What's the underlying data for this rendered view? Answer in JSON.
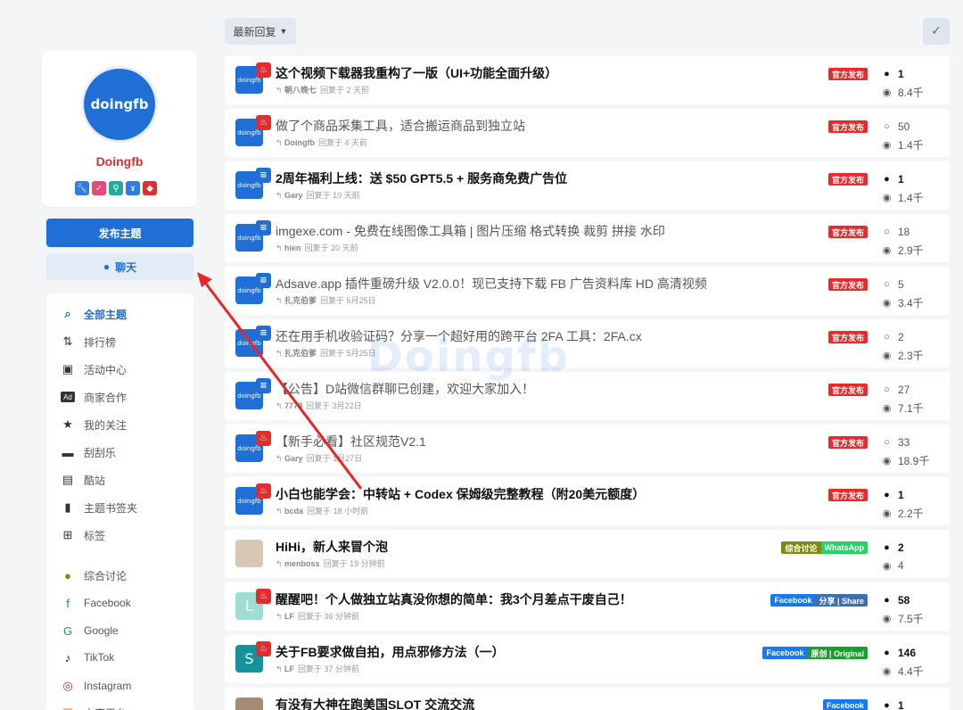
{
  "profile": {
    "avatar_text": "doingfb",
    "name": "Doingfb",
    "badges": [
      {
        "icon": "wrench-icon",
        "glyph": "🔧",
        "color": "#2f7ae5"
      },
      {
        "icon": "check-icon",
        "glyph": "✓",
        "color": "#e64a78"
      },
      {
        "icon": "user-icon",
        "glyph": "⚲",
        "color": "#26a99a"
      },
      {
        "icon": "trophy-icon",
        "glyph": "ɤ",
        "color": "#2f7ae5"
      },
      {
        "icon": "gem-icon",
        "glyph": "◆",
        "color": "#e02d2d"
      }
    ]
  },
  "actions": {
    "post_label": "发布主题",
    "chat_label": "聊天"
  },
  "nav": [
    {
      "label": "全部主题",
      "icon": "discussions-icon",
      "glyph": "⌕",
      "active": true
    },
    {
      "label": "排行榜",
      "icon": "ranking-icon",
      "glyph": "⇅",
      "active": false
    },
    {
      "label": "活动中心",
      "icon": "gift-icon",
      "glyph": "▣",
      "active": false
    },
    {
      "label": "商家合作",
      "icon": "ad-icon",
      "glyph": "Ad",
      "active": false
    },
    {
      "label": "我的关注",
      "icon": "star-icon",
      "glyph": "★",
      "active": false
    },
    {
      "label": "刮刮乐",
      "icon": "ticket-icon",
      "glyph": "▬",
      "active": false
    },
    {
      "label": "酷站",
      "icon": "window-icon",
      "glyph": "▤",
      "active": false
    },
    {
      "label": "主题书签夹",
      "icon": "bookmark-icon",
      "glyph": "▮",
      "active": false
    },
    {
      "label": "标签",
      "icon": "tags-icon",
      "glyph": "⊞",
      "active": false
    },
    {
      "label": "综合讨论",
      "icon": "comments-icon",
      "glyph": "●",
      "active": false,
      "color": "#7a8c12"
    },
    {
      "label": "Facebook",
      "icon": "facebook-icon",
      "glyph": "f",
      "active": false,
      "color": "#1877f2"
    },
    {
      "label": "Google",
      "icon": "google-icon",
      "glyph": "G",
      "active": false,
      "color": "#1a9b4b"
    },
    {
      "label": "TikTok",
      "icon": "tiktok-icon",
      "glyph": "♪",
      "active": false,
      "color": "#111111"
    },
    {
      "label": "Instagram",
      "icon": "instagram-icon",
      "glyph": "◎",
      "active": false,
      "color": "#c2185b"
    },
    {
      "label": "内容平台",
      "icon": "platform-icon",
      "glyph": "▦",
      "active": false,
      "color": "#e67e22"
    }
  ],
  "toolbar": {
    "sort_label": "最新回复"
  },
  "watermark": "Doingfb",
  "topics": [
    {
      "title": "这个视频下载器我重构了一版（UI+功能全面升级）",
      "bold": true,
      "user": "朝八晚七",
      "time": "回复于 2 天前",
      "avatar": "doingfb",
      "flag_color": "#e02d2d",
      "flag_glyph": "♨",
      "tags": [
        {
          "text": "官方发布",
          "color": "#e52b2b"
        }
      ],
      "replies": "1",
      "replies_bold": true,
      "views": "8.4千"
    },
    {
      "title": "做了个商品采集工具，适合搬运商品到独立站",
      "bold": false,
      "user": "Doingfb",
      "time": "回复于 4 天前",
      "avatar": "doingfb",
      "flag_color": "#e02d2d",
      "flag_glyph": "♨",
      "tags": [
        {
          "text": "官方发布",
          "color": "#e52b2b"
        }
      ],
      "replies": "50",
      "replies_bold": false,
      "views": "1.4千"
    },
    {
      "title": "2周年福利上线：送 $50 GPT5.5 + 服务商免费广告位",
      "bold": true,
      "user": "Gary",
      "time": "回复于 10 天前",
      "avatar": "doingfb",
      "flag_color": "#1f6fd6",
      "flag_glyph": "≡",
      "tags": [
        {
          "text": "官方发布",
          "color": "#e52b2b"
        }
      ],
      "replies": "1",
      "replies_bold": true,
      "views": "1.4千"
    },
    {
      "title": "imgexe.com - 免费在线图像工具箱 | 图片压缩 格式转换 裁剪 拼接 水印",
      "bold": false,
      "user": "hien",
      "time": "回复于 20 天前",
      "avatar": "doingfb",
      "flag_color": "#1f6fd6",
      "flag_glyph": "≡",
      "tags": [
        {
          "text": "官方发布",
          "color": "#e52b2b"
        }
      ],
      "replies": "18",
      "replies_bold": false,
      "views": "2.9千"
    },
    {
      "title": "Adsave.app 插件重磅升级 V2.0.0！现已支持下载 FB 广告资料库 HD 高清视频",
      "bold": false,
      "user": "扎克伯爹",
      "time": "回复于 5月25日",
      "avatar": "doingfb",
      "flag_color": "#1f6fd6",
      "flag_glyph": "≡",
      "tags": [
        {
          "text": "官方发布",
          "color": "#e52b2b"
        }
      ],
      "replies": "5",
      "replies_bold": false,
      "views": "3.4千"
    },
    {
      "title": "还在用手机收验证码？分享一个超好用的跨平台 2FA 工具：2FA.cx",
      "bold": false,
      "user": "扎克伯爹",
      "time": "回复于 5月25日",
      "avatar": "doingfb",
      "flag_color": "#1f6fd6",
      "flag_glyph": "≡",
      "tags": [
        {
          "text": "官方发布",
          "color": "#e52b2b"
        }
      ],
      "replies": "2",
      "replies_bold": false,
      "views": "2.3千"
    },
    {
      "title": "【公告】D站微信群聊已创建，欢迎大家加入！",
      "bold": false,
      "user": "7778",
      "time": "回复于 3月22日",
      "avatar": "doingfb",
      "flag_color": "#1f6fd6",
      "flag_glyph": "≡",
      "tags": [
        {
          "text": "官方发布",
          "color": "#e52b2b"
        }
      ],
      "replies": "27",
      "replies_bold": false,
      "views": "7.1千"
    },
    {
      "title": "【新手必看】社区规范V2.1",
      "bold": false,
      "user": "Gary",
      "time": "回复于 1月27日",
      "avatar": "doingfb",
      "flag_color": "#e02d2d",
      "flag_glyph": "♨",
      "tags": [
        {
          "text": "官方发布",
          "color": "#e52b2b"
        }
      ],
      "replies": "33",
      "replies_bold": false,
      "views": "18.9千"
    },
    {
      "title": "小白也能学会：中转站 + Codex 保姆级完整教程（附20美元额度）",
      "bold": true,
      "user": "bcda",
      "time": "回复于 18 小时前",
      "avatar": "doingfb",
      "flag_color": "#e02d2d",
      "flag_glyph": "♨",
      "tags": [
        {
          "text": "官方发布",
          "color": "#e52b2b"
        }
      ],
      "replies": "1",
      "replies_bold": true,
      "views": "2.2千"
    },
    {
      "title": "HiHi，新人来冒个泡",
      "bold": true,
      "user": "menboss",
      "time": "回复于 19 分钟前",
      "avatar": "photo",
      "flag_color": "",
      "flag_glyph": "",
      "tags": [
        {
          "text": "综合讨论",
          "color": "#7a8c12"
        },
        {
          "text": "WhatsApp",
          "color": "#25d366"
        }
      ],
      "replies": "2",
      "replies_bold": true,
      "views": "4"
    },
    {
      "title": "醒醒吧！个人做独立站真没你想的简单：我3个月差点干废自己！",
      "bold": true,
      "user": "LF",
      "time": "回复于 36 分钟前",
      "avatar": "L",
      "avatar_color": "#9fdcd4",
      "flag_color": "#e02d2d",
      "flag_glyph": "♨",
      "tags": [
        {
          "text": "Facebook",
          "color": "#1877f2"
        },
        {
          "text": "分享 | Share",
          "color": "#3d6fb0"
        }
      ],
      "replies": "58",
      "replies_bold": true,
      "views": "7.5千"
    },
    {
      "title": "关于FB要求做自拍，用点邪修方法（一）",
      "bold": true,
      "user": "LF",
      "time": "回复于 37 分钟前",
      "avatar": "S",
      "avatar_color": "#14939c",
      "flag_color": "#e02d2d",
      "flag_glyph": "♨",
      "tags": [
        {
          "text": "Facebook",
          "color": "#1877f2"
        },
        {
          "text": "原创 | Original",
          "color": "#1a9e2b"
        }
      ],
      "replies": "146",
      "replies_bold": true,
      "views": "4.4千"
    },
    {
      "title": "有没有大神在跑美国SLOT 交流交流",
      "bold": true,
      "user": "",
      "time": "",
      "avatar": "photo2",
      "flag_color": "",
      "flag_glyph": "",
      "tags": [
        {
          "text": "Facebook",
          "color": "#1877f2"
        }
      ],
      "replies": "1",
      "replies_bold": true,
      "views": ""
    }
  ]
}
